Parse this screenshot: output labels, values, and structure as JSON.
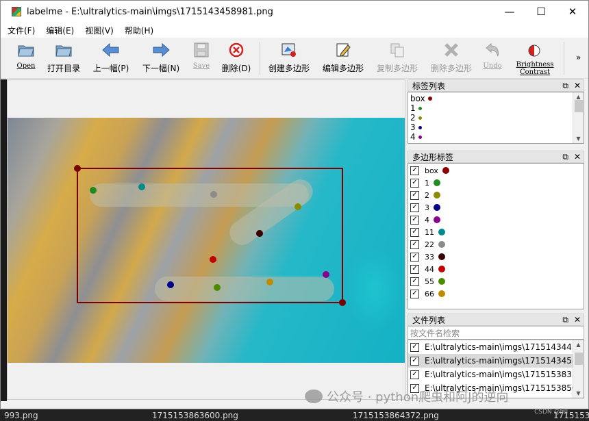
{
  "window": {
    "title": "labelme - E:\\ultralytics-main\\imgs\\1715143458981.png"
  },
  "window_controls": {
    "minimize": "—",
    "maximize": "☐",
    "close": "✕"
  },
  "menu": [
    "文件(F)",
    "编辑(E)",
    "视图(V)",
    "帮助(H)"
  ],
  "toolbar": {
    "open": "Open",
    "open_dir": "打开目录",
    "prev": "上一幅(P)",
    "next": "下一幅(N)",
    "save": "Save",
    "delete_file": "删除(D)",
    "create_polygon": "创建多边形",
    "edit_polygon": "编辑多边形",
    "copy_polygon": "复制多边形",
    "delete_polygon": "删除多边形",
    "undo": "Undo",
    "brightness_line1": "Brightness",
    "brightness_line2": "Contrast",
    "overflow": "»"
  },
  "label_list": {
    "title": "标签列表",
    "items": [
      {
        "label": "box",
        "color": "#8b0000"
      },
      {
        "label": "1",
        "color": "#228b22"
      },
      {
        "label": "2",
        "color": "#8b8b00"
      },
      {
        "label": "3",
        "color": "#00008b"
      },
      {
        "label": "4",
        "color": "#8b008b"
      }
    ]
  },
  "polygon_labels": {
    "title": "多边形标签",
    "items": [
      {
        "label": "box",
        "color": "#8b0000"
      },
      {
        "label": "1",
        "color": "#228b22"
      },
      {
        "label": "2",
        "color": "#8b8b00"
      },
      {
        "label": "3",
        "color": "#00008b"
      },
      {
        "label": "4",
        "color": "#8b008b"
      },
      {
        "label": "11",
        "color": "#008b8b"
      },
      {
        "label": "22",
        "color": "#8b8b8b"
      },
      {
        "label": "33",
        "color": "#3b0000"
      },
      {
        "label": "44",
        "color": "#c00000"
      },
      {
        "label": "55",
        "color": "#4a8b00"
      },
      {
        "label": "66",
        "color": "#c08b00"
      }
    ]
  },
  "file_list": {
    "title": "文件列表",
    "search_placeholder": "按文件名检索",
    "items": [
      "E:\\ultralytics-main\\imgs\\17151434454",
      "E:\\ultralytics-main\\imgs\\17151434589",
      "E:\\ultralytics-main\\imgs\\17151538339",
      "E:\\ultralytics-main\\imgs\\17151538504"
    ],
    "selected_index": 1
  },
  "dock_buttons": {
    "float": "⧉",
    "close": "✕"
  },
  "background": {
    "files": [
      "993.png",
      "1715153863600.png",
      "1715153864372.png",
      "1715153"
    ],
    "watermark": "公众号 · python爬虫和阿J的逆向",
    "csdn": "CSDN @阿J"
  }
}
